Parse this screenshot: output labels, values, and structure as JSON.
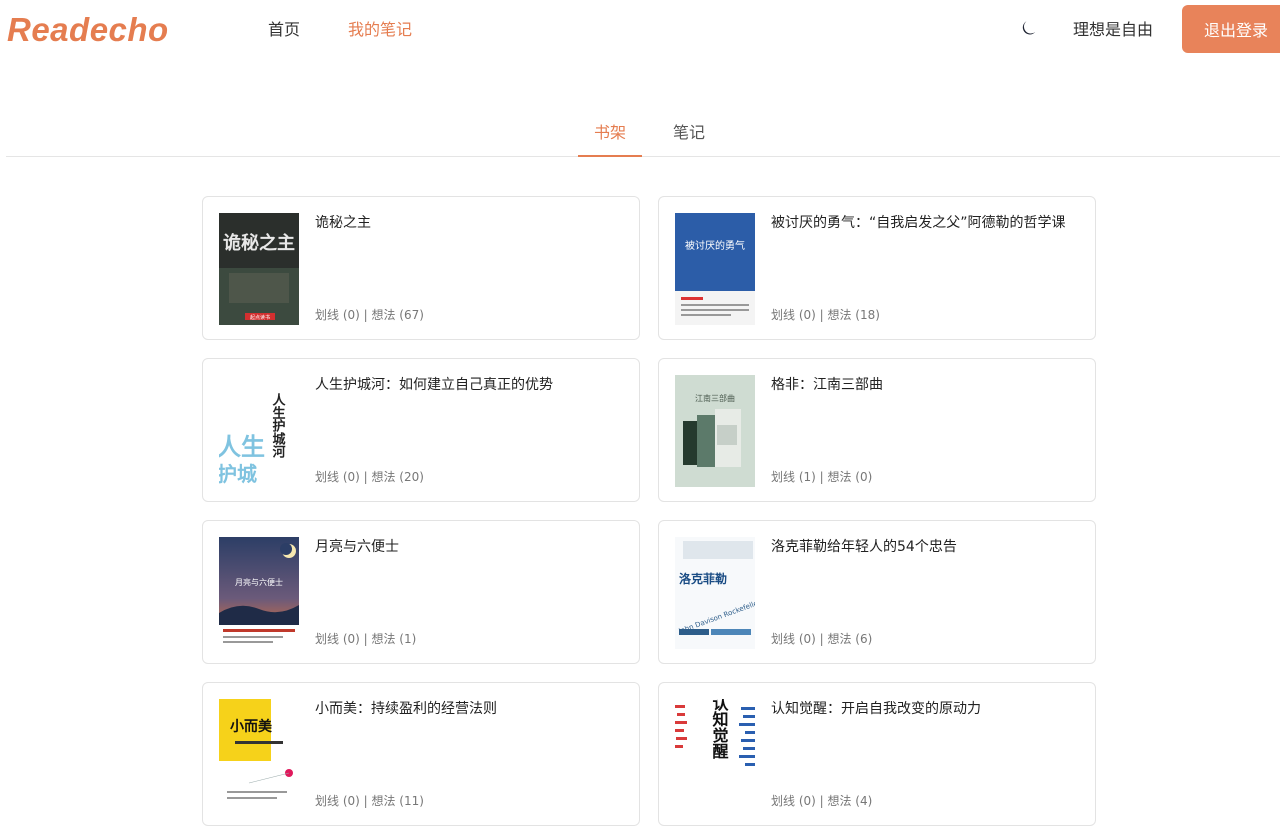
{
  "header": {
    "logo": "Readecho",
    "nav": {
      "home": "首页",
      "my_notes": "我的笔记"
    },
    "username": "理想是自由",
    "logout_label": "退出登录",
    "theme_icon": "moon-icon",
    "accent_color": "#E57D50"
  },
  "tabs": {
    "shelf": "书架",
    "notes": "笔记",
    "active": "书架"
  },
  "books": [
    {
      "title": "诡秘之主",
      "stats": "划线 (0) | 想法 (67)"
    },
    {
      "title": "被讨厌的勇气：“自我启发之父”阿德勒的哲学课",
      "stats": "划线 (0) | 想法 (18)"
    },
    {
      "title": "人生护城河：如何建立自己真正的优势",
      "stats": "划线 (0) | 想法 (20)"
    },
    {
      "title": "格非：江南三部曲",
      "stats": "划线 (1) | 想法 (0)"
    },
    {
      "title": "月亮与六便士",
      "stats": "划线 (0) | 想法 (1)"
    },
    {
      "title": "洛克菲勒给年轻人的54个忠告",
      "stats": "划线 (0) | 想法 (6)"
    },
    {
      "title": "小而美：持续盈利的经营法则",
      "stats": "划线 (0) | 想法 (11)"
    },
    {
      "title": "认知觉醒：开启自我改变的原动力",
      "stats": "划线 (0) | 想法 (4)"
    }
  ],
  "covers": [
    {
      "text": "诡秘之主",
      "badge": "起点读书"
    },
    {
      "text": "被讨厌的勇气"
    },
    {
      "text": "人生护城河"
    },
    {
      "text": "江南三部曲"
    },
    {
      "text": "月亮与六便士"
    },
    {
      "text": "洛克菲勒",
      "subtext": "John Davison Rockefeller"
    },
    {
      "text": "小而美"
    },
    {
      "text": "认知觉醒"
    }
  ]
}
